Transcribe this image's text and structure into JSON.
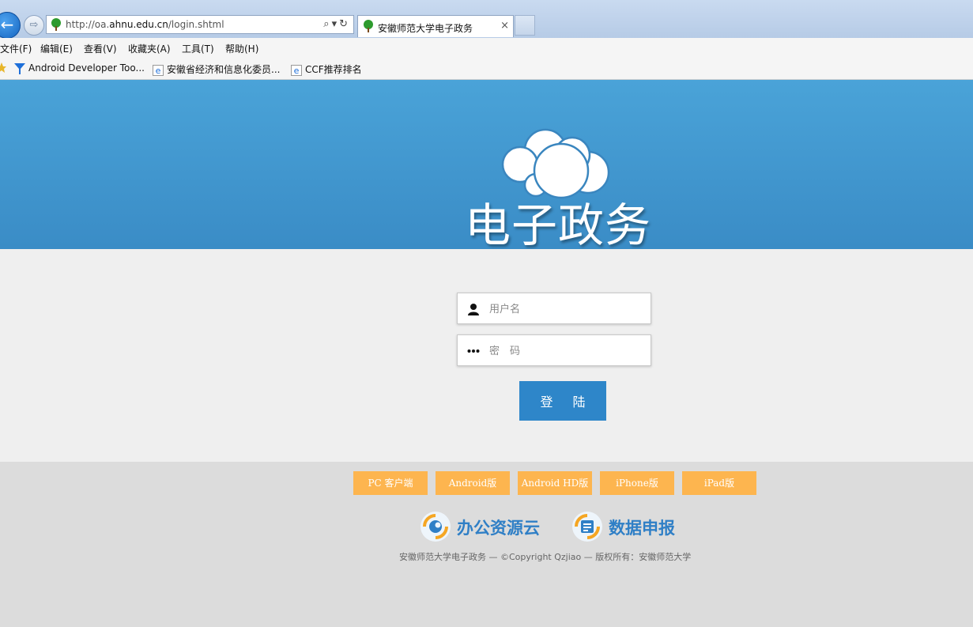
{
  "browser": {
    "url_prefix": "http://oa.",
    "url_domain": "ahnu.edu.cn",
    "url_path": "/login.shtml",
    "tab_title": "安徽师范大学电子政务",
    "tab_close": "×",
    "back_glyph": "←",
    "forward_glyph": "⇨",
    "address_tools": "⌕▾↻"
  },
  "menu": [
    "文件(F)",
    "编辑(E)",
    "查看(V)",
    "收藏夹(A)",
    "工具(T)",
    "帮助(H)"
  ],
  "favorites": [
    {
      "label": "Android Developer Too...",
      "icon": "funnel-icon"
    },
    {
      "label": "安徽省经济和信息化委员...",
      "icon": "ie-icon"
    },
    {
      "label": "CCF推荐排名",
      "icon": "ie-icon"
    }
  ],
  "logo": {
    "title": "电子政务"
  },
  "login": {
    "username_placeholder": "用户名",
    "password_placeholder": "密　码",
    "submit_label": "登 陆"
  },
  "downloads": [
    "PC 客户端",
    "Android版",
    "Android HD版",
    "iPhone版",
    "iPad版"
  ],
  "services": [
    {
      "label": "办公资源云",
      "icon": "cloud-resource-icon"
    },
    {
      "label": "数据申报",
      "icon": "data-report-icon"
    }
  ],
  "copyright": "安徽师范大学电子政务 — ©Copyright Qzjiao — 版权所有：安徽师范大学",
  "colors": {
    "hero": "#4aa3d8",
    "login_button": "#2e86c9",
    "download_button": "#fdb54f",
    "service_text": "#2f7fc6"
  }
}
